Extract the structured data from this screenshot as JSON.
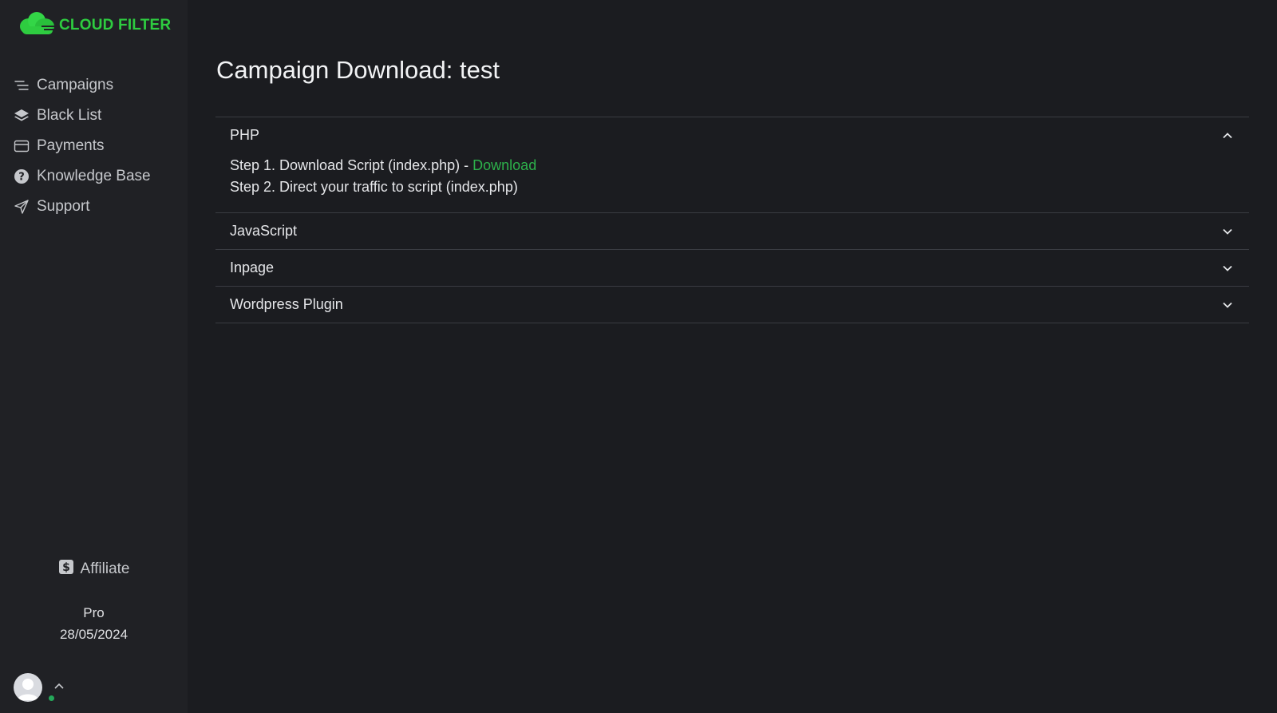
{
  "brand": {
    "name": "CLOUD FILTER",
    "accent": "#2ecc40"
  },
  "sidebar": {
    "items": [
      {
        "label": "Campaigns",
        "icon": "menu-lines-icon"
      },
      {
        "label": "Black List",
        "icon": "layers-icon"
      },
      {
        "label": "Payments",
        "icon": "credit-card-icon"
      },
      {
        "label": "Knowledge Base",
        "icon": "question-circle-icon"
      },
      {
        "label": "Support",
        "icon": "paper-plane-icon"
      }
    ],
    "affiliate_label": "Affiliate",
    "plan_name": "Pro",
    "plan_date": "28/05/2024"
  },
  "main": {
    "title": "Campaign Download: test",
    "sections": [
      {
        "label": "PHP",
        "expanded": true,
        "step1_text": "Step 1. Download Script (index.php) - ",
        "step1_link": "Download",
        "step2_text": "Step 2. Direct your traffic to script (index.php)"
      },
      {
        "label": "JavaScript",
        "expanded": false
      },
      {
        "label": "Inpage",
        "expanded": false
      },
      {
        "label": "Wordpress Plugin",
        "expanded": false
      }
    ]
  }
}
